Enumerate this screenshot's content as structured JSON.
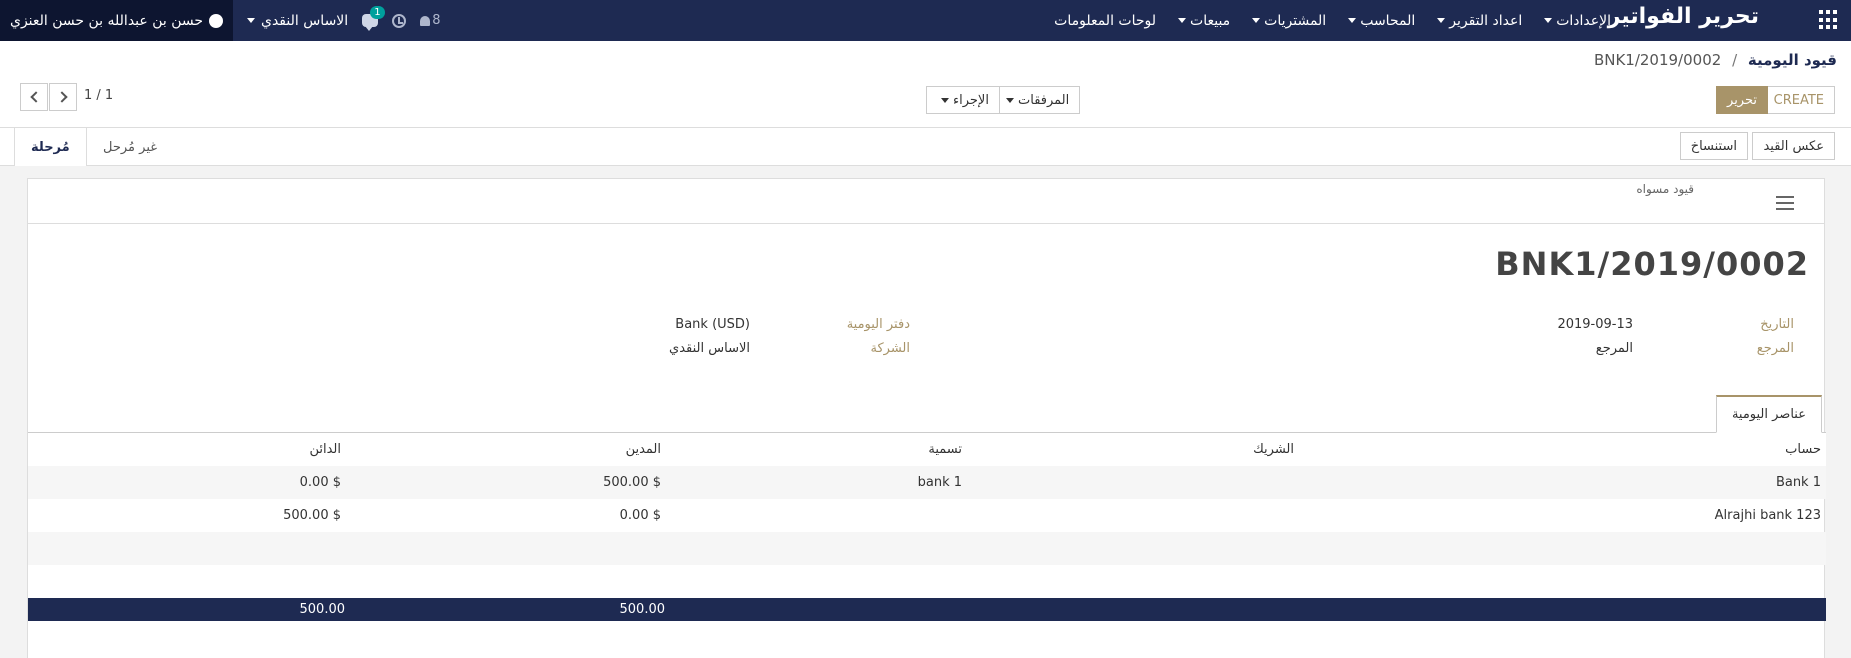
{
  "navbar": {
    "brand": "تحرير الفواتير",
    "menu": [
      {
        "label": "لوحات المعلومات",
        "caret": false
      },
      {
        "label": "مبيعات",
        "caret": true
      },
      {
        "label": "المشتريات",
        "caret": true
      },
      {
        "label": "المحاسب",
        "caret": true
      },
      {
        "label": "اعداد التقرير",
        "caret": true
      },
      {
        "label": "الإعدادات",
        "caret": true
      }
    ],
    "user_name": "حسن بن عبدالله بن حسن العنزي",
    "company": "الاساس النقدي",
    "chat_badge": "1",
    "bell_count": "8"
  },
  "breadcrumb": {
    "parent": "قيود اليومية",
    "separator": "/",
    "current": "BNK1/2019/0002"
  },
  "buttons": {
    "edit": "تحرير",
    "create": "CREATE",
    "attachments": "المرفقات",
    "action": "الإجراء",
    "reverse": "عكس القيد",
    "duplicate": "استنساخ"
  },
  "pager": {
    "value": "1 / 1"
  },
  "states": {
    "posted": "مُرحلة",
    "unposted": "غير مُرحل"
  },
  "sheet": {
    "tag": "قيود مسواه",
    "title": "BNK1/2019/0002",
    "fields": {
      "date_label": "التاريخ",
      "date_value": "2019-09-13",
      "ref_label": "المرجع",
      "ref_value": "المرجع",
      "journal_label": "دفتر اليومية",
      "journal_value": "Bank (USD)",
      "company_label": "الشركة",
      "company_value": "الاساس النقدي"
    },
    "tab": "عناصر اليومية"
  },
  "table": {
    "headers": {
      "account": "حساب",
      "partner": "الشريك",
      "label": "تسمية",
      "debit": "المدين",
      "credit": "الدائن"
    },
    "rows": [
      {
        "account": "Bank 1",
        "partner": "",
        "label": "bank 1",
        "debit": "500.00 $",
        "credit": "0.00 $"
      },
      {
        "account": "Alrajhi bank 123",
        "partner": "",
        "label": "",
        "debit": "0.00 $",
        "credit": "500.00 $"
      }
    ],
    "totals": {
      "debit": "500.00",
      "credit": "500.00"
    }
  },
  "colors": {
    "navbar": "#1e2a52",
    "accent": "#a89469",
    "total_row": "#1e2a52"
  }
}
